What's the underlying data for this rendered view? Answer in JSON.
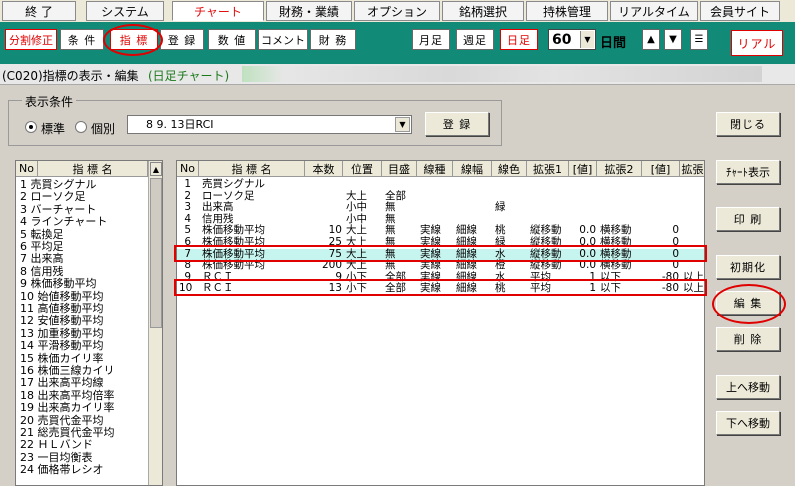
{
  "menu": {
    "tabs": [
      {
        "label": "終 了"
      },
      {
        "label": "システム"
      },
      {
        "label": "チャート"
      },
      {
        "label": "財務・業績"
      },
      {
        "label": "オプション"
      },
      {
        "label": "銘柄選択"
      },
      {
        "label": "持株管理"
      },
      {
        "label": "リアルタイム"
      },
      {
        "label": "会員サイト"
      }
    ],
    "active_index": 2
  },
  "toolbar": {
    "split_label": "分割修正",
    "condition_label": "条 件",
    "indicator_label": "指 標",
    "register_label": "登 録",
    "value_label": "数 値",
    "comment_label": "コメント",
    "finance_label": "財 務",
    "monthly_label": "月足",
    "weekly_label": "週足",
    "daily_label": "日足",
    "period_value": "60",
    "period_unit": "日間",
    "up_glyph": "▲",
    "down_glyph": "▼",
    "menu_glyph": "☰",
    "real_label": "リアル"
  },
  "status": {
    "code_title": "(C020)指標の表示・編集",
    "chart_type": "(日足チャート)"
  },
  "display_conditions": {
    "group_label": "表示条件",
    "standard_label": "標準",
    "individual_label": "個別",
    "selected_mode": "標準",
    "preset_value": "8 9. 13日RCI",
    "register_button": "登 録"
  },
  "buttons": {
    "close": "閉じる",
    "chart_display": "ﾁｬｰﾄ表示",
    "print": "印 刷",
    "initialize": "初期化",
    "edit": "編 集",
    "delete": "削 除",
    "move_up": "上へ移動",
    "move_down": "下へ移動"
  },
  "indicator_list": {
    "col_no": "No",
    "col_name": "指 標 名",
    "items": [
      "1 売買シグナル",
      "2 ローソク足",
      "3 バーチャート",
      "4 ラインチャート",
      "5 転換足",
      "6 平均足",
      "7 出来高",
      "8 信用残",
      "9 株価移動平均",
      "10 始値移動平均",
      "11 高値移動平均",
      "12 安値移動平均",
      "13 加重移動平均",
      "14 平滑移動平均",
      "15 株価カイリ率",
      "16 株価三線カイリ",
      "17 出来高平均線",
      "18 出来高平均倍率",
      "19 出来高カイリ率",
      "20 売買代金平均",
      "21 総売買代金平均",
      "22 ＨＬバンド",
      "23 一目均衡表",
      "24 価格帯レシオ"
    ]
  },
  "selected_table": {
    "headers": [
      "No",
      "指 標 名",
      "本数",
      "位置",
      "目盛",
      "線種",
      "線幅",
      "線色",
      "拡張1",
      "[値]",
      "拡張2",
      "[値]",
      "拡張"
    ],
    "rows": [
      [
        "1",
        "売買シグナル",
        "",
        "",
        "",
        "",
        "",
        "",
        "",
        "",
        "",
        "",
        ""
      ],
      [
        "2",
        "ローソク足",
        "",
        "大上",
        "全部",
        "",
        "",
        "",
        "",
        "",
        "",
        "",
        ""
      ],
      [
        "3",
        "出来高",
        "",
        "小中",
        "無",
        "",
        "",
        "緑",
        "",
        "",
        "",
        "",
        ""
      ],
      [
        "4",
        "信用残",
        "",
        "小中",
        "無",
        "",
        "",
        "",
        "",
        "",
        "",
        "",
        ""
      ],
      [
        "5",
        "株価移動平均",
        "10",
        "大上",
        "無",
        "実線",
        "細線",
        "桃",
        "縦移動",
        "0.0",
        "横移動",
        "0",
        ""
      ],
      [
        "6",
        "株価移動平均",
        "25",
        "大上",
        "無",
        "実線",
        "細線",
        "緑",
        "縦移動",
        "0.0",
        "横移動",
        "0",
        ""
      ],
      [
        "7",
        "株価移動平均",
        "75",
        "大上",
        "無",
        "実線",
        "細線",
        "水",
        "縦移動",
        "0.0",
        "横移動",
        "0",
        ""
      ],
      [
        "8",
        "株価移動平均",
        "200",
        "大上",
        "無",
        "実線",
        "細線",
        "橙",
        "縦移動",
        "0.0",
        "横移動",
        "0",
        ""
      ],
      [
        "9",
        "ＲＣＩ",
        "9",
        "小下",
        "全部",
        "実線",
        "細線",
        "水",
        "平均",
        "1",
        "以下",
        "-80",
        "以上"
      ],
      [
        "10",
        "ＲＣＩ",
        "13",
        "小下",
        "全部",
        "実線",
        "細線",
        "桃",
        "平均",
        "1",
        "以下",
        "-80",
        "以上"
      ]
    ],
    "highlighted_rows": [
      7,
      10
    ]
  },
  "colors": {
    "toolbar_bg": "#128a78",
    "annotation_red": "#e00000",
    "selected_row": "#c6f5f0"
  }
}
